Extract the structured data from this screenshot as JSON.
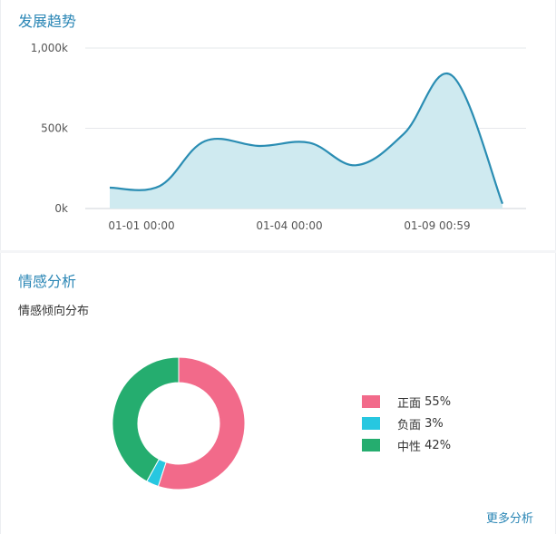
{
  "trend": {
    "title": "发展趋势"
  },
  "sentiment": {
    "title": "情感分析",
    "subtitle": "情感倾向分布",
    "more_label": "更多分析"
  },
  "chart_data": [
    {
      "type": "area",
      "title": "",
      "xlabel": "",
      "ylabel": "",
      "x_ticks": [
        "01-01 00:00",
        "01-04 00:00",
        "01-09 00:59"
      ],
      "y_ticks": [
        "0k",
        "500k",
        "1,000k"
      ],
      "ylim": [
        0,
        1000000
      ],
      "grid": true,
      "color": "#2a8db3",
      "fill_color": "#cfeaf0",
      "series": [
        {
          "values": [
            130000,
            140000,
            420000,
            390000,
            410000,
            270000,
            470000,
            830000,
            30000
          ]
        }
      ]
    },
    {
      "type": "pie",
      "donut": true,
      "legend_position": "right",
      "slices": [
        {
          "label": "正面",
          "percent_label": "55%",
          "value": 55,
          "color": "#f26a8a"
        },
        {
          "label": "负面",
          "percent_label": "3%",
          "value": 3,
          "color": "#27c7e0"
        },
        {
          "label": "中性",
          "percent_label": "42%",
          "value": 42,
          "color": "#25ad6f"
        }
      ]
    }
  ]
}
